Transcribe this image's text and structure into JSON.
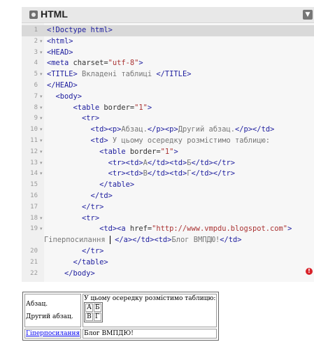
{
  "editor": {
    "title": "HTML",
    "collapse_icon": "chevron-down-icon",
    "lines": [
      {
        "num": "1",
        "fold": "",
        "segs": [
          {
            "t": "<!Doctype html>",
            "c": "tag"
          }
        ]
      },
      {
        "num": "2",
        "fold": "▾",
        "segs": [
          {
            "t": "<html>",
            "c": "tag"
          }
        ]
      },
      {
        "num": "3",
        "fold": "▾",
        "segs": [
          {
            "t": "<HEAD>",
            "c": "tag"
          }
        ]
      },
      {
        "num": "4",
        "fold": "",
        "segs": [
          {
            "t": "<meta ",
            "c": "tag"
          },
          {
            "t": "charset=",
            "c": ""
          },
          {
            "t": "\"utf-8\"",
            "c": "str"
          },
          {
            "t": ">",
            "c": "tag"
          }
        ]
      },
      {
        "num": "5",
        "fold": "▾",
        "segs": [
          {
            "t": "<TITLE>",
            "c": "tag"
          },
          {
            "t": " Вкладені таблиці ",
            "c": "txt"
          },
          {
            "t": "</TITLE>",
            "c": "tag"
          }
        ]
      },
      {
        "num": "6",
        "fold": "",
        "segs": [
          {
            "t": "</HEAD>",
            "c": "tag"
          }
        ]
      },
      {
        "num": "7",
        "fold": "▾",
        "segs": [
          {
            "t": "  <body>",
            "c": "tag"
          }
        ]
      },
      {
        "num": "8",
        "fold": "▾",
        "segs": [
          {
            "t": "      <table ",
            "c": "tag"
          },
          {
            "t": "border=",
            "c": ""
          },
          {
            "t": "\"1\"",
            "c": "str"
          },
          {
            "t": ">",
            "c": "tag"
          }
        ]
      },
      {
        "num": "9",
        "fold": "▾",
        "segs": [
          {
            "t": "        <tr>",
            "c": "tag"
          }
        ]
      },
      {
        "num": "10",
        "fold": "▾",
        "segs": [
          {
            "t": "          <td><p>",
            "c": "tag"
          },
          {
            "t": "Абзац.",
            "c": "txt"
          },
          {
            "t": "</p><p>",
            "c": "tag"
          },
          {
            "t": "Другий абзац.",
            "c": "txt"
          },
          {
            "t": "</p></td>",
            "c": "tag"
          }
        ]
      },
      {
        "num": "11",
        "fold": "▾",
        "segs": [
          {
            "t": "          <td>",
            "c": "tag"
          },
          {
            "t": " У цьому осередку розмістимо таблицю:",
            "c": "txt"
          }
        ]
      },
      {
        "num": "12",
        "fold": "▾",
        "segs": [
          {
            "t": "            <table ",
            "c": "tag"
          },
          {
            "t": "border=",
            "c": ""
          },
          {
            "t": "\"1\"",
            "c": "str"
          },
          {
            "t": ">",
            "c": "tag"
          }
        ]
      },
      {
        "num": "13",
        "fold": "▾",
        "segs": [
          {
            "t": "              <tr><td>",
            "c": "tag"
          },
          {
            "t": "А",
            "c": "txt"
          },
          {
            "t": "</td><td>",
            "c": "tag"
          },
          {
            "t": "Б",
            "c": "txt"
          },
          {
            "t": "</td></tr>",
            "c": "tag"
          }
        ]
      },
      {
        "num": "14",
        "fold": "▾",
        "segs": [
          {
            "t": "              <tr><td>",
            "c": "tag"
          },
          {
            "t": "В",
            "c": "txt"
          },
          {
            "t": "</td><td>",
            "c": "tag"
          },
          {
            "t": "Г",
            "c": "txt"
          },
          {
            "t": "</td></tr>",
            "c": "tag"
          }
        ]
      },
      {
        "num": "15",
        "fold": "",
        "segs": [
          {
            "t": "            </table>",
            "c": "tag"
          }
        ]
      },
      {
        "num": "16",
        "fold": "",
        "segs": [
          {
            "t": "          </td>",
            "c": "tag"
          }
        ]
      },
      {
        "num": "17",
        "fold": "",
        "segs": [
          {
            "t": "        </tr>",
            "c": "tag"
          }
        ]
      },
      {
        "num": "18",
        "fold": "▾",
        "segs": [
          {
            "t": "        <tr>",
            "c": "tag"
          }
        ]
      },
      {
        "num": "19",
        "fold": "▾",
        "segs": [
          {
            "t": "            <td><a ",
            "c": "tag"
          },
          {
            "t": "href=",
            "c": ""
          },
          {
            "t": "\"http://www.vmpdu.blogspot.com\"",
            "c": "str"
          },
          {
            "t": ">",
            "c": "tag"
          }
        ]
      },
      {
        "num": "",
        "fold": "",
        "segs": [
          {
            "t": "Гіперпосилання ",
            "c": "txt"
          },
          {
            "t": "CURSOR",
            "c": "cursor"
          },
          {
            "t": " </a></td><td>",
            "c": "tag"
          },
          {
            "t": "Блог ВМПДЮ!",
            "c": "txt"
          },
          {
            "t": "</td>",
            "c": "tag"
          }
        ],
        "wrap": true
      },
      {
        "num": "20",
        "fold": "",
        "segs": [
          {
            "t": "        </tr>",
            "c": "tag"
          }
        ]
      },
      {
        "num": "21",
        "fold": "",
        "segs": [
          {
            "t": "      </table>",
            "c": "tag"
          }
        ]
      },
      {
        "num": "22",
        "fold": "",
        "segs": [
          {
            "t": "    </body>",
            "c": "tag"
          }
        ]
      }
    ],
    "error_icon": "error-icon",
    "error_glyph": "!"
  },
  "preview": {
    "p1": "Абзац.",
    "p2": "Другий абзац.",
    "cell_text": "У цьому осередку розмістимо таблицю:",
    "inner": [
      [
        "А",
        "Б"
      ],
      [
        "В",
        "Г"
      ]
    ],
    "link_text": "Гіперпосилання",
    "blog_text": "Блог ВМПДЮ!"
  }
}
